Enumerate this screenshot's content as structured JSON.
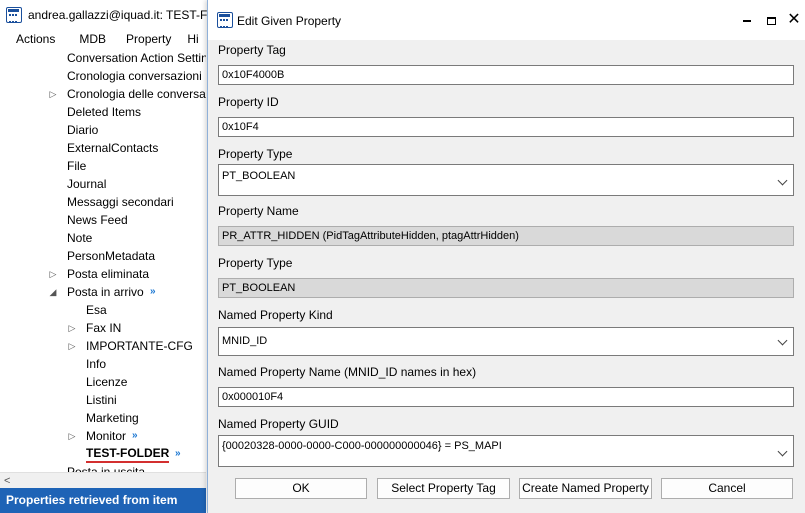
{
  "main": {
    "title": "andrea.gallazzi@iquad.it: TEST-FOLDER",
    "menu": [
      "Actions",
      "MDB",
      "Property",
      "Hi"
    ],
    "tree": [
      {
        "label": "Conversation Action Settings",
        "arrow": ""
      },
      {
        "label": "Cronologia conversazioni",
        "arrow": ""
      },
      {
        "label": "Cronologia delle conversazioni",
        "arrow": "right"
      },
      {
        "label": "Deleted Items",
        "arrow": ""
      },
      {
        "label": "Diario",
        "arrow": ""
      },
      {
        "label": "ExternalContacts",
        "arrow": ""
      },
      {
        "label": "File",
        "arrow": ""
      },
      {
        "label": "Journal",
        "arrow": ""
      },
      {
        "label": "Messaggi secondari",
        "arrow": ""
      },
      {
        "label": "News Feed",
        "arrow": ""
      },
      {
        "label": "Note",
        "arrow": ""
      },
      {
        "label": "PersonMetadata",
        "arrow": ""
      },
      {
        "label": "Posta eliminata",
        "arrow": "right"
      },
      {
        "label": "Posta in arrivo",
        "arrow": "down",
        "sync": true
      },
      {
        "label": "Esa",
        "arrow": "",
        "level": 2
      },
      {
        "label": "Fax IN",
        "arrow": "right",
        "level": 2
      },
      {
        "label": "IMPORTANTE-CFG",
        "arrow": "right",
        "level": 2
      },
      {
        "label": "Info",
        "arrow": "",
        "level": 2
      },
      {
        "label": "Licenze",
        "arrow": "",
        "level": 2
      },
      {
        "label": "Listini",
        "arrow": "",
        "level": 2
      },
      {
        "label": "Marketing",
        "arrow": "",
        "level": 2
      },
      {
        "label": "Monitor",
        "arrow": "right",
        "level": 2,
        "sync": true
      },
      {
        "label": "TEST-FOLDER",
        "arrow": "",
        "level": 2,
        "sync": true,
        "selected": true
      },
      {
        "label": "Posta in uscita",
        "arrow": ""
      }
    ],
    "scroll_left": "<",
    "status": "Properties retrieved from item",
    "sync_glyph": "»",
    "accent_color": "#1e63b6",
    "underline_color": "#d32f2f"
  },
  "dialog": {
    "title": "Edit Given Property",
    "property_tag_label": "Property Tag",
    "property_tag_value": "0x10F4000B",
    "property_id_label": "Property ID",
    "property_id_value": "0x10F4",
    "property_type_label": "Property Type",
    "property_type_value": "PT_BOOLEAN",
    "property_name_label": "Property Name",
    "property_name_value": "PR_ATTR_HIDDEN (PidTagAttributeHidden, ptagAttrHidden)",
    "property_type2_label": "Property Type",
    "property_type2_value": "PT_BOOLEAN",
    "named_kind_label": "Named Property Kind",
    "named_kind_value": "MNID_ID",
    "named_name_label": "Named Property Name (MNID_ID names in hex)",
    "named_name_value": "0x000010F4",
    "named_guid_label": "Named Property GUID",
    "named_guid_value": "{00020328-0000-0000-C000-000000000046} = PS_MAPI",
    "buttons": {
      "ok": "OK",
      "select_tag": "Select Property Tag",
      "create_named": "Create Named Property",
      "cancel": "Cancel"
    },
    "close_glyph": "✕"
  }
}
